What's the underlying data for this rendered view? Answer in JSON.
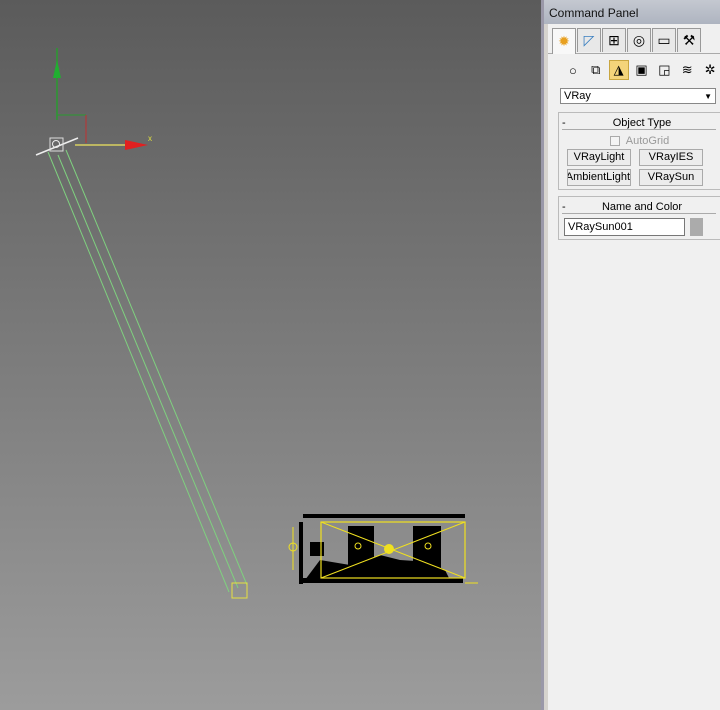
{
  "viewport": {
    "axis_x_label": "x",
    "colors": {
      "sun_line": "#7fd07f",
      "target": "#e6e040",
      "x_axis": "#e02020",
      "y_axis": "#20b030",
      "scene": "#f0e020"
    }
  },
  "command_panel": {
    "title": "Command Panel",
    "tabs": [
      {
        "name": "create",
        "icon": "sun-star-icon",
        "active": true
      },
      {
        "name": "modify",
        "icon": "curve-icon"
      },
      {
        "name": "hierarchy",
        "icon": "hierarchy-icon"
      },
      {
        "name": "motion",
        "icon": "motion-icon"
      },
      {
        "name": "display",
        "icon": "monitor-icon"
      },
      {
        "name": "utilities",
        "icon": "hammer-icon"
      }
    ],
    "categories": [
      {
        "icon": "sphere-icon"
      },
      {
        "icon": "shapes-icon"
      },
      {
        "icon": "light-icon",
        "active": true
      },
      {
        "icon": "camera-icon"
      },
      {
        "icon": "helper-icon"
      },
      {
        "icon": "spacewarp-icon"
      },
      {
        "icon": "systems-icon"
      }
    ],
    "dropdown": {
      "value": "VRay"
    },
    "object_type": {
      "title": "Object Type",
      "collapse": "-",
      "autogrid": "AutoGrid",
      "buttons": [
        "VRayLight",
        "VRayIES",
        "VRayAmbientLight",
        "VRaySun"
      ]
    },
    "name_color": {
      "title": "Name and Color",
      "collapse": "-",
      "name": "VRaySun001",
      "color": "#ababab"
    }
  }
}
